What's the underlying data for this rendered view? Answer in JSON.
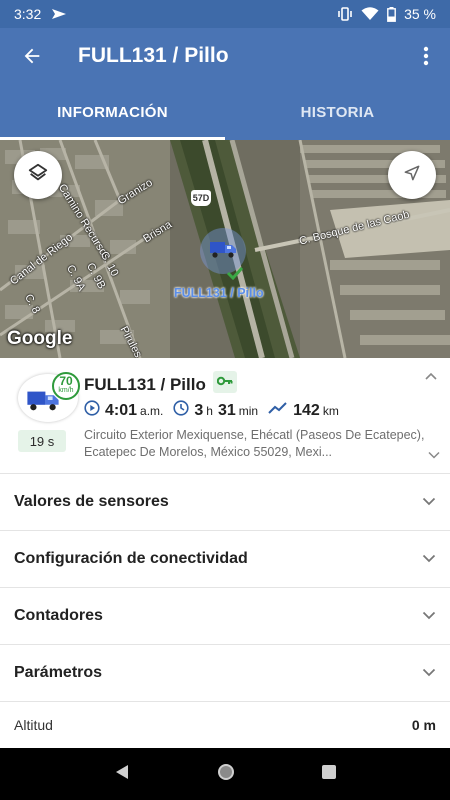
{
  "status_bar": {
    "time": "3:32",
    "battery": "35 %"
  },
  "app_bar": {
    "title": "FULL131 / Pillo",
    "back_icon": "arrow-back-icon",
    "more_icon": "more-vert-icon"
  },
  "tabs": [
    {
      "label": "INFORMACIÓN",
      "active": true
    },
    {
      "label": "HISTORIA",
      "active": false
    }
  ],
  "map": {
    "labels": {
      "camino_recursos": "Camino Recursos",
      "granizo": "Granizo",
      "brisna": "Brisna",
      "canal_de_riego": "Canal de Riego",
      "c10": "C. 10",
      "c9b": "C. 9B",
      "c9a": "C. 9A",
      "c8": "C. 8",
      "pirules": "Pirules",
      "bosque": "C. Bosque de las Caob",
      "route_shield": "57D"
    },
    "vehicle_label": "FULL131 / Pillo",
    "attribution": "Google"
  },
  "info": {
    "vehicle_name": "FULL131 / Pillo",
    "speed": "70",
    "speed_unit": "km/h",
    "timer": "19 s",
    "time": "4:01",
    "time_suffix": "a.m.",
    "duration_h": "3",
    "duration_h_unit": "h",
    "duration_min": "31",
    "duration_min_unit": "min",
    "distance": "142",
    "distance_unit": "km",
    "address": "Circuito Exterior Mexiquense, Ehécatl (Paseos De Ecatepec), Ecatepec De Morelos, México 55029, Mexi..."
  },
  "sections": [
    {
      "label": "Valores de sensores"
    },
    {
      "label": "Configuración de conectividad"
    },
    {
      "label": "Contadores"
    },
    {
      "label": "Parámetros"
    }
  ],
  "altitude": {
    "label": "Altitud",
    "value": "0 m"
  },
  "colors": {
    "primary": "#4a74b4",
    "status_bar": "#3e6aa8",
    "accent_green": "#2e9a3b",
    "chip_bg": "#e5f3e8",
    "stat_icon": "#2f5fa6"
  }
}
